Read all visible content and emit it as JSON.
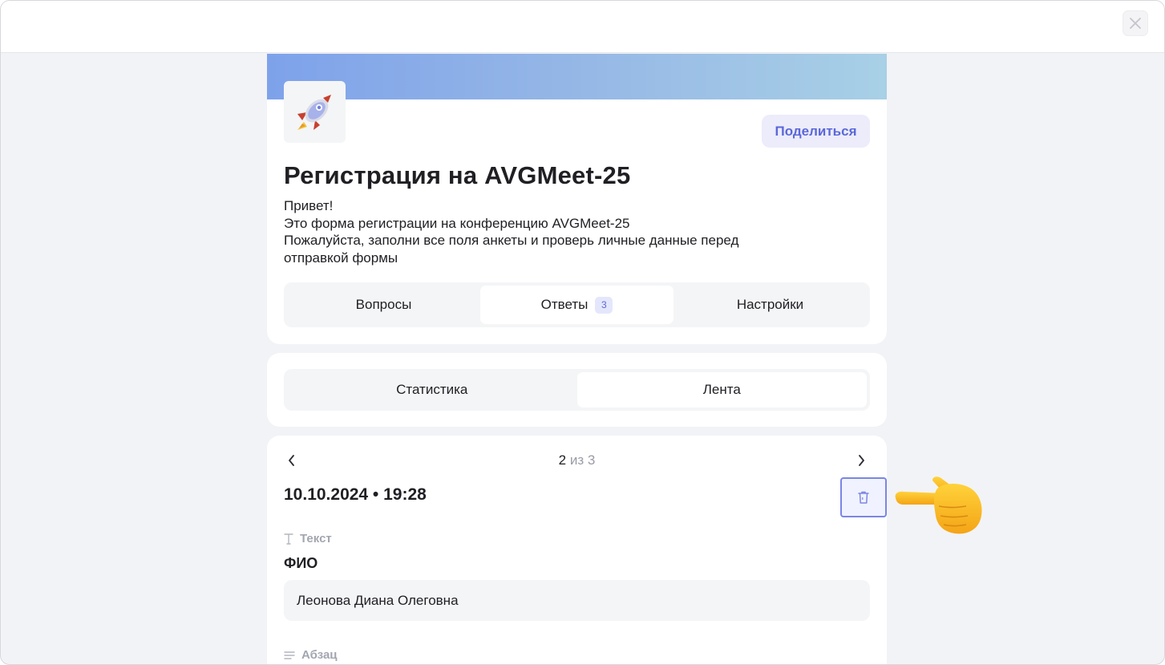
{
  "header": {
    "close_icon": "close-icon"
  },
  "form": {
    "logo_icon": "rocket-icon",
    "share_label": "Поделиться",
    "title": "Регистрация на AVGMeet-25",
    "description_lines": [
      "Привет!",
      "Это форма регистрации на конференцию AVGMeet-25",
      "Пожалуйста, заполни все поля анкеты и проверь личные данные перед",
      "отправкой формы"
    ],
    "tabs": [
      {
        "label": "Вопросы",
        "active": false
      },
      {
        "label": "Ответы",
        "badge": "3",
        "active": true
      },
      {
        "label": "Настройки",
        "active": false
      }
    ]
  },
  "view_tabs": [
    {
      "label": "Статистика",
      "active": false
    },
    {
      "label": "Лента",
      "active": true
    }
  ],
  "response": {
    "current": "2",
    "of_total": "из 3",
    "timestamp": "10.10.2024 • 19:28",
    "delete_icon": "trash-icon",
    "questions": [
      {
        "type_label": "Текст",
        "type_icon": "text-type-icon",
        "label": "ФИО",
        "answer": "Леонова Диана Олеговна"
      },
      {
        "type_label": "Абзац",
        "type_icon": "paragraph-type-icon"
      }
    ]
  },
  "overlay": {
    "pointer_icon": "pointing-hand-icon"
  },
  "colors": {
    "accent": "#5b68d8",
    "cover_start": "#7ea2ea",
    "cover_end": "#a8d0e6",
    "background": "#f2f3f6"
  }
}
